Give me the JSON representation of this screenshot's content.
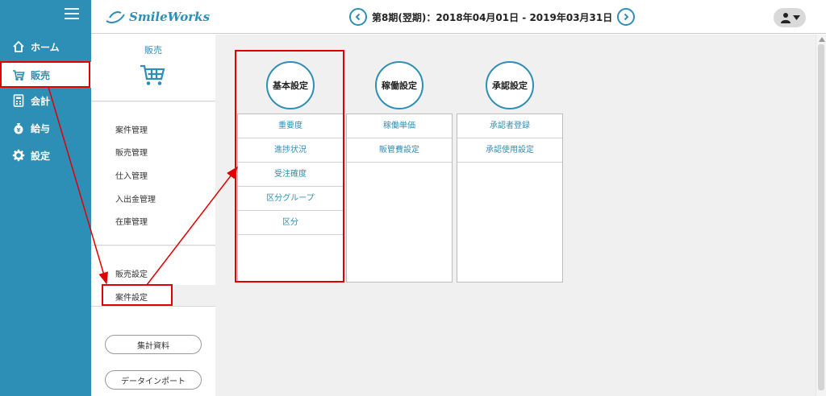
{
  "nav": {
    "items": [
      {
        "label": "ホーム",
        "icon": "home-icon"
      },
      {
        "label": "販売",
        "icon": "cart-icon"
      },
      {
        "label": "会計",
        "icon": "calculator-icon"
      },
      {
        "label": "給与",
        "icon": "money-bag-icon"
      },
      {
        "label": "設定",
        "icon": "gear-icon"
      }
    ]
  },
  "header": {
    "logo_text": "SmileWorks",
    "period": "第8期(翌期)：2018年04月01日 - 2019年03月31日"
  },
  "submenu": {
    "title": "販売",
    "links": [
      "案件管理",
      "販売管理",
      "仕入管理",
      "入出金管理",
      "在庫管理"
    ],
    "settings_links": [
      "販売設定",
      "案件設定"
    ],
    "buttons": [
      "集計資料",
      "データインポート"
    ]
  },
  "columns": [
    {
      "title": "基本設定",
      "items": [
        "重要度",
        "進捗状況",
        "受注確度",
        "区分グループ",
        "区分"
      ]
    },
    {
      "title": "稼働設定",
      "items": [
        "稼働単価",
        "販管費設定"
      ]
    },
    {
      "title": "承認設定",
      "items": [
        "承認者登録",
        "承認使用設定"
      ]
    }
  ],
  "colors": {
    "accent": "#2d8fb6",
    "annotation": "#e10000"
  }
}
